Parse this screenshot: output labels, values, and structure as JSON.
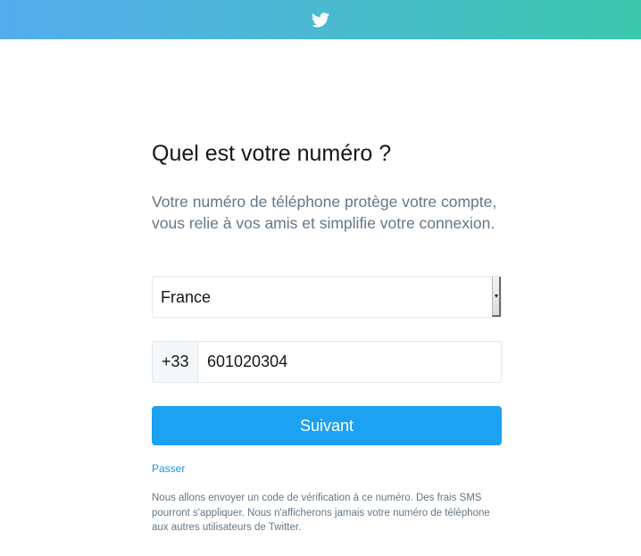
{
  "header": {
    "logo_icon": "twitter-bird-icon",
    "gradient_start": "#55acee",
    "gradient_end": "#3cc8ad"
  },
  "main": {
    "title": "Quel est votre numéro ?",
    "subtitle": "Votre numéro de téléphone protège votre compte, vous relie à vos amis et simplifie votre connexion.",
    "country_select": {
      "selected": "France"
    },
    "phone": {
      "prefix": "+33",
      "value": "601020304"
    },
    "next_button_label": "Suivant",
    "skip_link_label": "Passer",
    "disclaimer": "Nous allons envoyer un code de vérification à ce numéro. Des frais SMS pourront s'appliquer. Nous n'afficherons jamais votre numéro de téléphone aux autres utilisateurs de Twitter."
  },
  "colors": {
    "accent": "#1da1f2",
    "link": "#1b95e0",
    "muted_text": "#657786"
  }
}
